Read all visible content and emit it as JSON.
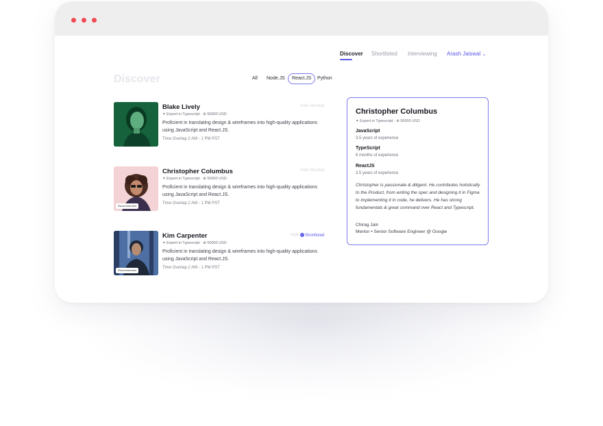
{
  "nav": {
    "tabs": [
      {
        "label": "Discover",
        "active": true
      },
      {
        "label": "Shortlisted",
        "active": false
      },
      {
        "label": "Interviewing",
        "active": false
      }
    ],
    "user_name": "Arash Jaiswal",
    "user_chevron": "⌄"
  },
  "page": {
    "title": "Discover"
  },
  "filters": [
    {
      "label": "All",
      "selected": false
    },
    {
      "label": "Node.JS",
      "selected": false
    },
    {
      "label": "React.JS",
      "selected": true
    },
    {
      "label": "Python",
      "selected": false
    }
  ],
  "candidates": [
    {
      "name": "Blake Lively",
      "expertise": "✦ Expert in Typescript",
      "salary": "⊕ 50000 USD",
      "description": "Proficient in translating design & wireframes into high-quality applications using JavaScript and React.JS.",
      "timezone": "Time Overlap  2 AM - 1 PM PST",
      "actions": "Hide   Shortlist",
      "shortlisted": false,
      "recommended": false,
      "photo_bg": "#1d7a4a"
    },
    {
      "name": "Christopher Columbus",
      "expertise": "✦ Expert in Typescript",
      "salary": "⊕ 50000 USD",
      "description": "Proficient in translating design & wireframes into high-quality applications using JavaScript and React.JS.",
      "timezone": "Time Overlap  2 AM - 1 PM PST",
      "actions": "Hide   Shortlist",
      "shortlisted": false,
      "recommended": true,
      "recommended_label": "Recommended",
      "photo_bg": "#f4d3d6"
    },
    {
      "name": "Kim Carpenter",
      "expertise": "✦ Expert in Typescript",
      "salary": "⊕ 50000 USD",
      "description": "Proficient in translating design & wireframes into high-quality applications using JavaScript and React.JS.",
      "timezone": "Time Overlap  2 AM - 1 PM PST",
      "hide_label": "Hide",
      "shortlisted_label": "Shortlisted",
      "shortlisted": true,
      "recommended": true,
      "recommended_label": "Recommended",
      "photo_bg": "#3d5a8a"
    }
  ],
  "detail": {
    "name": "Christopher Columbus",
    "expertise": "✦ Expert in Typescript",
    "salary": "⊕ 50000 USD",
    "skills": [
      {
        "name": "JavaScript",
        "experience": "3.5 years of experience"
      },
      {
        "name": "TypeScript",
        "experience": "6 months of experience"
      },
      {
        "name": "ReactJS",
        "experience": "3.5 years of experience"
      }
    ],
    "testimonial": "Christopher is passionate & diligent. He contributes holistically to the Product, from writing the spec and designing it in Figma to implementing it in code, he delivers. He has strong fundamentals & great command over React and Typescript.",
    "mentor_name": "Chirag Jain",
    "mentor_title": "Mentor • Senior Software Engineer @ Google"
  },
  "colors": {
    "accent": "#5b57e8",
    "window_dots": "#f04a54",
    "titlebar": "#eeeeee"
  }
}
